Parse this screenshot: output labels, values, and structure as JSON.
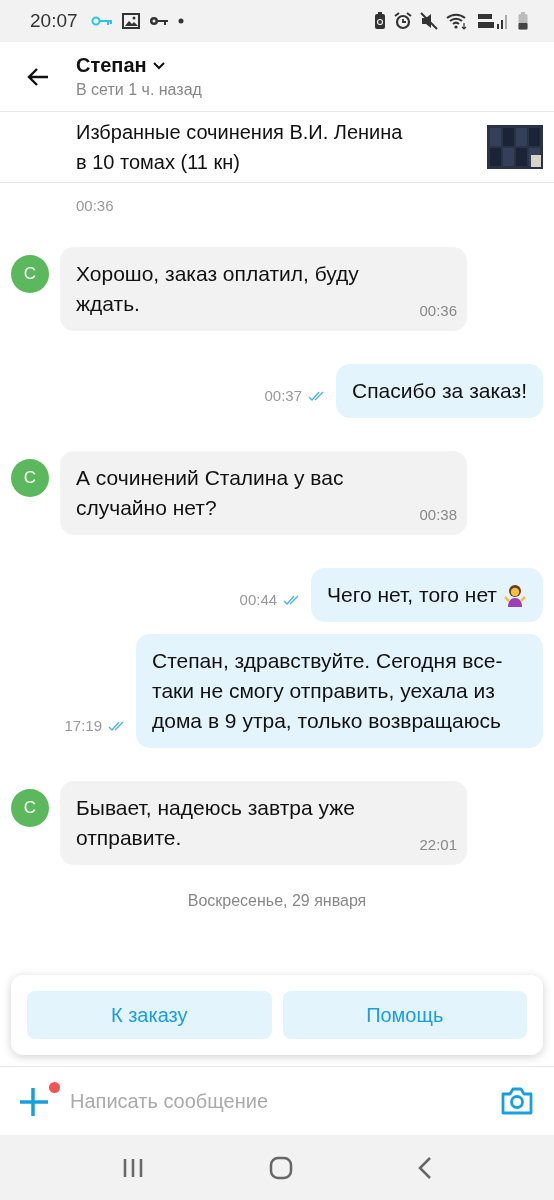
{
  "status_bar": {
    "time": "20:07"
  },
  "header": {
    "contact_name": "Степан",
    "presence": "В сети 1 ч. назад"
  },
  "product": {
    "title": "Избранные сочинения В.И. Ленина в 10 томах (11 кн)"
  },
  "messages": [
    {
      "kind": "timestamp",
      "time": "00:36"
    },
    {
      "kind": "incoming",
      "avatar": "С",
      "text": "Хорошо, заказ оплатил, буду ждать.",
      "time": "00:36"
    },
    {
      "kind": "outgoing",
      "text": "Спасибо за заказ!",
      "time": "00:37",
      "read": true
    },
    {
      "kind": "incoming",
      "avatar": "С",
      "text": "А сочинений Сталина у вас случайно нет?",
      "time": "00:38"
    },
    {
      "kind": "outgoing",
      "text": "Чего нет, того нет",
      "time": "00:44",
      "read": true,
      "emoji": true
    },
    {
      "kind": "outgoing",
      "text": "Степан, здравствуйте. Сегодня все-таки не смогу отправить, уехала из дома в 9 утра, только возвращаюсь",
      "time": "17:19",
      "read": true
    },
    {
      "kind": "incoming",
      "avatar": "С",
      "text": "Бывает, надеюсь завтра уже отправите.",
      "time": "22:01"
    },
    {
      "kind": "date",
      "text": "Воскресенье, 29 января"
    }
  ],
  "actions": [
    "К заказу",
    "Помощь"
  ],
  "composer": {
    "placeholder": "Написать сообщение",
    "attachment_badge": true
  }
}
